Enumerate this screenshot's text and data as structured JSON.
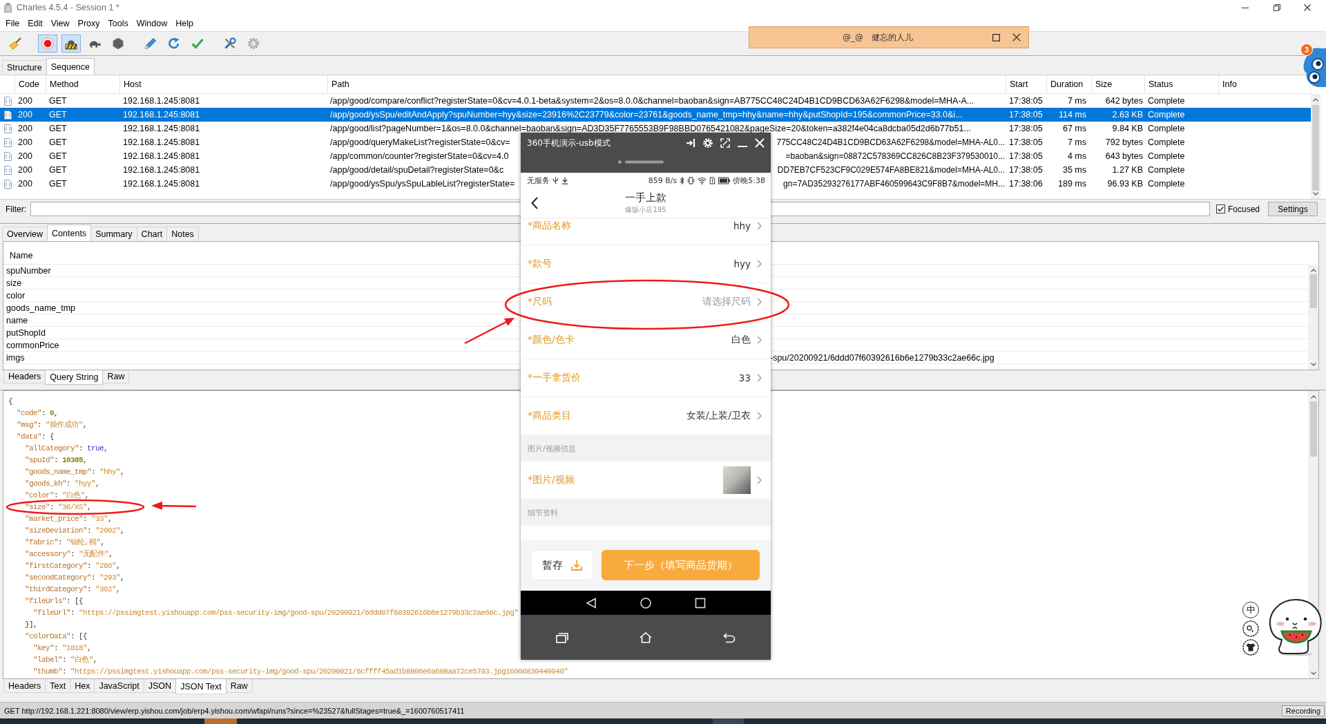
{
  "window": {
    "title": "Charles 4.5.4 - Session 1 *"
  },
  "menu": [
    "File",
    "Edit",
    "View",
    "Proxy",
    "Tools",
    "Window",
    "Help"
  ],
  "toolbar": [
    {
      "pressed": false
    },
    {
      "pressed": true
    },
    {
      "pressed": true
    },
    {
      "pressed": false
    },
    {
      "pressed": false
    },
    {
      "pressed": false
    },
    {
      "pressed": false
    },
    {
      "pressed": false
    },
    {
      "pressed": false
    },
    {
      "pressed": false
    }
  ],
  "view_tabs": [
    {
      "label": "Structure",
      "selected": false
    },
    {
      "label": "Sequence",
      "selected": true
    }
  ],
  "table": {
    "columns": [
      "Code",
      "Method",
      "Host",
      "Path",
      "Start",
      "Duration",
      "Size",
      "Status",
      "Info"
    ],
    "rows": [
      {
        "selected": false,
        "code": "200",
        "method": "GET",
        "host": "192.168.1.245:8081",
        "path": "/app/good/compare/conflict?registerState=0&cv=4.0.1-beta&system=2&os=8.0.0&channel=baoban&sign=AB775CC48C24D4B1CD9BCD63A62F6298&model=MHA-A...",
        "start": "17:38:05",
        "duration": "7 ms",
        "size": "642 bytes",
        "status": "Complete"
      },
      {
        "selected": true,
        "code": "200",
        "method": "GET",
        "host": "192.168.1.245:8081",
        "path": "/app/good/ysSpu/editAndApply?spuNumber=hyy&size=23916%2C23779&color=23761&goods_name_tmp=hhy&name=hhy&putShopId=195&commonPrice=33.0&i...",
        "start": "17:38:05",
        "duration": "114 ms",
        "size": "2.63 KB",
        "status": "Complete"
      },
      {
        "selected": false,
        "code": "200",
        "method": "GET",
        "host": "192.168.1.245:8081",
        "path": "/app/good/list?pageNumber=1&os=8.0.0&channel=baoban&sign=AD3D35F7765553B9F98BBD0765421082&pageSize=20&token=a382f4e04ca8dcba05d2d6b77b51...",
        "start": "17:38:05",
        "duration": "67 ms",
        "size": "9.84 KB",
        "status": "Complete"
      },
      {
        "selected": false,
        "code": "200",
        "method": "GET",
        "host": "192.168.1.245:8081",
        "path": "/app/good/queryMakeList?registerState=0&cv=",
        "path_tail": "775CC48C24D4B1CD9BCD63A62F6298&model=MHA-AL0...",
        "start": "17:38:05",
        "duration": "7 ms",
        "size": "792 bytes",
        "status": "Complete"
      },
      {
        "selected": false,
        "code": "200",
        "method": "GET",
        "host": "192.168.1.245:8081",
        "path": "/app/common/counter?registerState=0&cv=4.0",
        "path_tail": "=baoban&sign=08872C578369CC826C8B23F379530010...",
        "start": "17:38:05",
        "duration": "4 ms",
        "size": "643 bytes",
        "status": "Complete"
      },
      {
        "selected": false,
        "code": "200",
        "method": "GET",
        "host": "192.168.1.245:8081",
        "path": "/app/good/detail/spuDetail?registerState=0&c",
        "path_tail": "DD7EB7CF523CF9C029E574FA8BE821&model=MHA-AL0...",
        "start": "17:38:05",
        "duration": "35 ms",
        "size": "1.27 KB",
        "status": "Complete"
      },
      {
        "selected": false,
        "code": "200",
        "method": "GET",
        "host": "192.168.1.245:8081",
        "path": "/app/good/ysSpu/ysSpuLableList?registerState=",
        "path_tail": "gn=7AD35293276177ABF460599643C9F8B7&model=MH...",
        "start": "17:38:06",
        "duration": "189 ms",
        "size": "96.93 KB",
        "status": "Complete"
      }
    ]
  },
  "filter": {
    "label": "Filter:",
    "focused": {
      "label": "Focused",
      "checked": true
    },
    "settings_button": "Settings"
  },
  "detail_tabs": [
    {
      "label": "Overview",
      "selected": false
    },
    {
      "label": "Contents",
      "selected": true
    },
    {
      "label": "Summary",
      "selected": false
    },
    {
      "label": "Chart",
      "selected": false
    },
    {
      "label": "Notes",
      "selected": false
    }
  ],
  "query_table": {
    "columns": [
      "Name"
    ],
    "rows": [
      {
        "name": "spuNumber"
      },
      {
        "name": "size"
      },
      {
        "name": "color"
      },
      {
        "name": "goods_name_tmp"
      },
      {
        "name": "name"
      },
      {
        "name": "putShopId"
      },
      {
        "name": "commonPrice"
      },
      {
        "name": "imgs",
        "value": "-spu/20200921/6ddd07f60392616b6e1279b33c2ae66c.jpg"
      }
    ]
  },
  "query_tabs": [
    {
      "label": "Headers",
      "selected": false
    },
    {
      "label": "Query String",
      "selected": true
    },
    {
      "label": "Raw",
      "selected": false
    }
  ],
  "response": {
    "lines": [
      {
        "tokens": [
          {
            "text": "{",
            "kind": "punct"
          }
        ],
        "children": [
          {
            "tokens": [
              {
                "text": "\"code\"",
                "kind": "key"
              },
              {
                "text": ": ",
                "kind": "punct"
              },
              {
                "text": "0",
                "kind": "number"
              },
              {
                "text": ",",
                "kind": "punct"
              }
            ]
          },
          {
            "tokens": [
              {
                "text": "\"msg\"",
                "kind": "key"
              },
              {
                "text": ": ",
                "kind": "punct"
              },
              {
                "text": "\"操作成功\"",
                "kind": "string"
              },
              {
                "text": ",",
                "kind": "punct"
              }
            ]
          },
          {
            "tokens": [
              {
                "text": "\"data\"",
                "kind": "key"
              },
              {
                "text": ": {",
                "kind": "punct"
              }
            ],
            "children": [
              {
                "tokens": [
                  {
                    "text": "\"allCategory\"",
                    "kind": "key"
                  },
                  {
                    "text": ": ",
                    "kind": "punct"
                  },
                  {
                    "text": "true",
                    "kind": "boolean"
                  },
                  {
                    "text": ",",
                    "kind": "punct"
                  }
                ]
              },
              {
                "tokens": [
                  {
                    "text": "\"spuId\"",
                    "kind": "key"
                  },
                  {
                    "text": ": ",
                    "kind": "punct"
                  },
                  {
                    "text": "10385",
                    "kind": "number"
                  },
                  {
                    "text": ",",
                    "kind": "punct"
                  }
                ]
              },
              {
                "tokens": [
                  {
                    "text": "\"goods_name_tmp\"",
                    "kind": "key"
                  },
                  {
                    "text": ": ",
                    "kind": "punct"
                  },
                  {
                    "text": "\"hhy\"",
                    "kind": "string"
                  },
                  {
                    "text": ",",
                    "kind": "punct"
                  }
                ]
              },
              {
                "tokens": [
                  {
                    "text": "\"goods_kh\"",
                    "kind": "key"
                  },
                  {
                    "text": ": ",
                    "kind": "punct"
                  },
                  {
                    "text": "\"hyy\"",
                    "kind": "string"
                  },
                  {
                    "text": ",",
                    "kind": "punct"
                  }
                ]
              },
              {
                "tokens": [
                  {
                    "text": "\"color\"",
                    "kind": "key"
                  },
                  {
                    "text": ": ",
                    "kind": "punct"
                  },
                  {
                    "text": "\"白色\"",
                    "kind": "string"
                  },
                  {
                    "text": ",",
                    "kind": "punct"
                  }
                ]
              },
              {
                "tokens": [
                  {
                    "text": "\"size\"",
                    "kind": "key"
                  },
                  {
                    "text": ": ",
                    "kind": "punct"
                  },
                  {
                    "text": "\"36/XS\"",
                    "kind": "string"
                  },
                  {
                    "text": ",",
                    "kind": "punct"
                  }
                ]
              },
              {
                "tokens": [
                  {
                    "text": "\"market_price\"",
                    "kind": "key"
                  },
                  {
                    "text": ": ",
                    "kind": "punct"
                  },
                  {
                    "text": "\"33\"",
                    "kind": "string"
                  },
                  {
                    "text": ",",
                    "kind": "punct"
                  }
                ]
              },
              {
                "tokens": [
                  {
                    "text": "\"sizeDeviation\"",
                    "kind": "key"
                  },
                  {
                    "text": ": ",
                    "kind": "punct"
                  },
                  {
                    "text": "\"2002\"",
                    "kind": "string"
                  },
                  {
                    "text": ",",
                    "kind": "punct"
                  }
                ]
              },
              {
                "tokens": [
                  {
                    "text": "\"fabric\"",
                    "kind": "key"
                  },
                  {
                    "text": ": ",
                    "kind": "punct"
                  },
                  {
                    "text": "\"锦纶,棉\"",
                    "kind": "string"
                  },
                  {
                    "text": ",",
                    "kind": "punct"
                  }
                ]
              },
              {
                "tokens": [
                  {
                    "text": "\"accessory\"",
                    "kind": "key"
                  },
                  {
                    "text": ": ",
                    "kind": "punct"
                  },
                  {
                    "text": "\"无配件\"",
                    "kind": "string"
                  },
                  {
                    "text": ",",
                    "kind": "punct"
                  }
                ]
              },
              {
                "tokens": [
                  {
                    "text": "\"firstCategory\"",
                    "kind": "key"
                  },
                  {
                    "text": ": ",
                    "kind": "punct"
                  },
                  {
                    "text": "\"286\"",
                    "kind": "string"
                  },
                  {
                    "text": ",",
                    "kind": "punct"
                  }
                ]
              },
              {
                "tokens": [
                  {
                    "text": "\"secondCategory\"",
                    "kind": "key"
                  },
                  {
                    "text": ": ",
                    "kind": "punct"
                  },
                  {
                    "text": "\"293\"",
                    "kind": "string"
                  },
                  {
                    "text": ",",
                    "kind": "punct"
                  }
                ]
              },
              {
                "tokens": [
                  {
                    "text": "\"thirdCategory\"",
                    "kind": "key"
                  },
                  {
                    "text": ": ",
                    "kind": "punct"
                  },
                  {
                    "text": "\"302\"",
                    "kind": "string"
                  },
                  {
                    "text": ",",
                    "kind": "punct"
                  }
                ]
              },
              {
                "tokens": [
                  {
                    "text": "\"fileUrls\"",
                    "kind": "key"
                  },
                  {
                    "text": ": [{",
                    "kind": "punct"
                  }
                ],
                "children": [
                  {
                    "tokens": [
                      {
                        "text": "\"fileUrl\"",
                        "kind": "key"
                      },
                      {
                        "text": ": ",
                        "kind": "punct"
                      },
                      {
                        "text": "\"https://pssimgtest.yishouapp.com/pss-security-img/good-spu/20200921/6ddd07f60392616b6e1279b33c2ae66c.jpg\"",
                        "kind": "string"
                      }
                    ]
                  }
                ]
              },
              {
                "tokens": [
                  {
                    "text": "}],",
                    "kind": "punct"
                  }
                ]
              },
              {
                "tokens": [
                  {
                    "text": "\"colorData\"",
                    "kind": "key"
                  },
                  {
                    "text": ": [{",
                    "kind": "punct"
                  }
                ],
                "children": [
                  {
                    "tokens": [
                      {
                        "text": "\"key\"",
                        "kind": "key"
                      },
                      {
                        "text": ": ",
                        "kind": "punct"
                      },
                      {
                        "text": "\"1018\"",
                        "kind": "string"
                      },
                      {
                        "text": ",",
                        "kind": "punct"
                      }
                    ]
                  },
                  {
                    "tokens": [
                      {
                        "text": "\"label\"",
                        "kind": "key"
                      },
                      {
                        "text": ": ",
                        "kind": "punct"
                      },
                      {
                        "text": "\"白色\"",
                        "kind": "string"
                      },
                      {
                        "text": ",",
                        "kind": "punct"
                      }
                    ]
                  },
                  {
                    "tokens": [
                      {
                        "text": "\"thumb\"",
                        "kind": "key"
                      },
                      {
                        "text": ": ",
                        "kind": "punct"
                      },
                      {
                        "text": "\"https://pssimgtest.yishouapp.com/pss-security-img/good-spu/20200921/6cffff45ad1b8806e0a698aa72ce5793.jpg16006830440040\"",
                        "kind": "string"
                      }
                    ]
                  }
                ]
              }
            ]
          }
        ]
      }
    ]
  },
  "response_tabs": [
    {
      "label": "Headers",
      "selected": false
    },
    {
      "label": "Text",
      "selected": false
    },
    {
      "label": "Hex",
      "selected": false
    },
    {
      "label": "JavaScript",
      "selected": false
    },
    {
      "label": "JSON",
      "selected": false
    },
    {
      "label": "JSON Text",
      "selected": true
    },
    {
      "label": "Raw",
      "selected": false
    }
  ],
  "status_bar": {
    "text": "GET http://192.168.1.221:8080/view/erp.yishou.com/job/erp4.yishou.com/wfapi/runs?since=%23527&fullStages=true&_=1600760517411",
    "recording": "Recording"
  },
  "notification": {
    "emoticon": "@_@",
    "text": "健忘的人儿"
  },
  "floating_widget": {
    "badge": "3"
  },
  "ime_toolbar": {
    "mode": "中"
  },
  "phone_window": {
    "title": "360手机演示-usb模式",
    "status_bar": {
      "carrier": "无服务",
      "speed": "859 B/s",
      "time": "傍晚5:38"
    },
    "header": {
      "title": "一手上款",
      "subtitle": "爆版小店195"
    },
    "rows": [
      {
        "kind": "field",
        "label": "*商品名称",
        "value": "hhy"
      },
      {
        "kind": "field",
        "label": "*款号",
        "value": "hyy"
      },
      {
        "kind": "field",
        "label": "*尺码",
        "placeholder": "请选择尺码"
      },
      {
        "kind": "field",
        "label": "*颜色/色卡",
        "value": "白色"
      },
      {
        "kind": "field",
        "label": "*一手拿货价",
        "value": "33"
      },
      {
        "kind": "field",
        "label": "*商品类目",
        "value": "女装/上装/卫衣"
      },
      {
        "kind": "section",
        "label": "图片/视频信息"
      },
      {
        "kind": "media",
        "label": "*图片/视频"
      },
      {
        "kind": "section",
        "label": "细节资料"
      }
    ],
    "save_button": "暂存",
    "next_button": "下一步（填写商品货期）"
  }
}
